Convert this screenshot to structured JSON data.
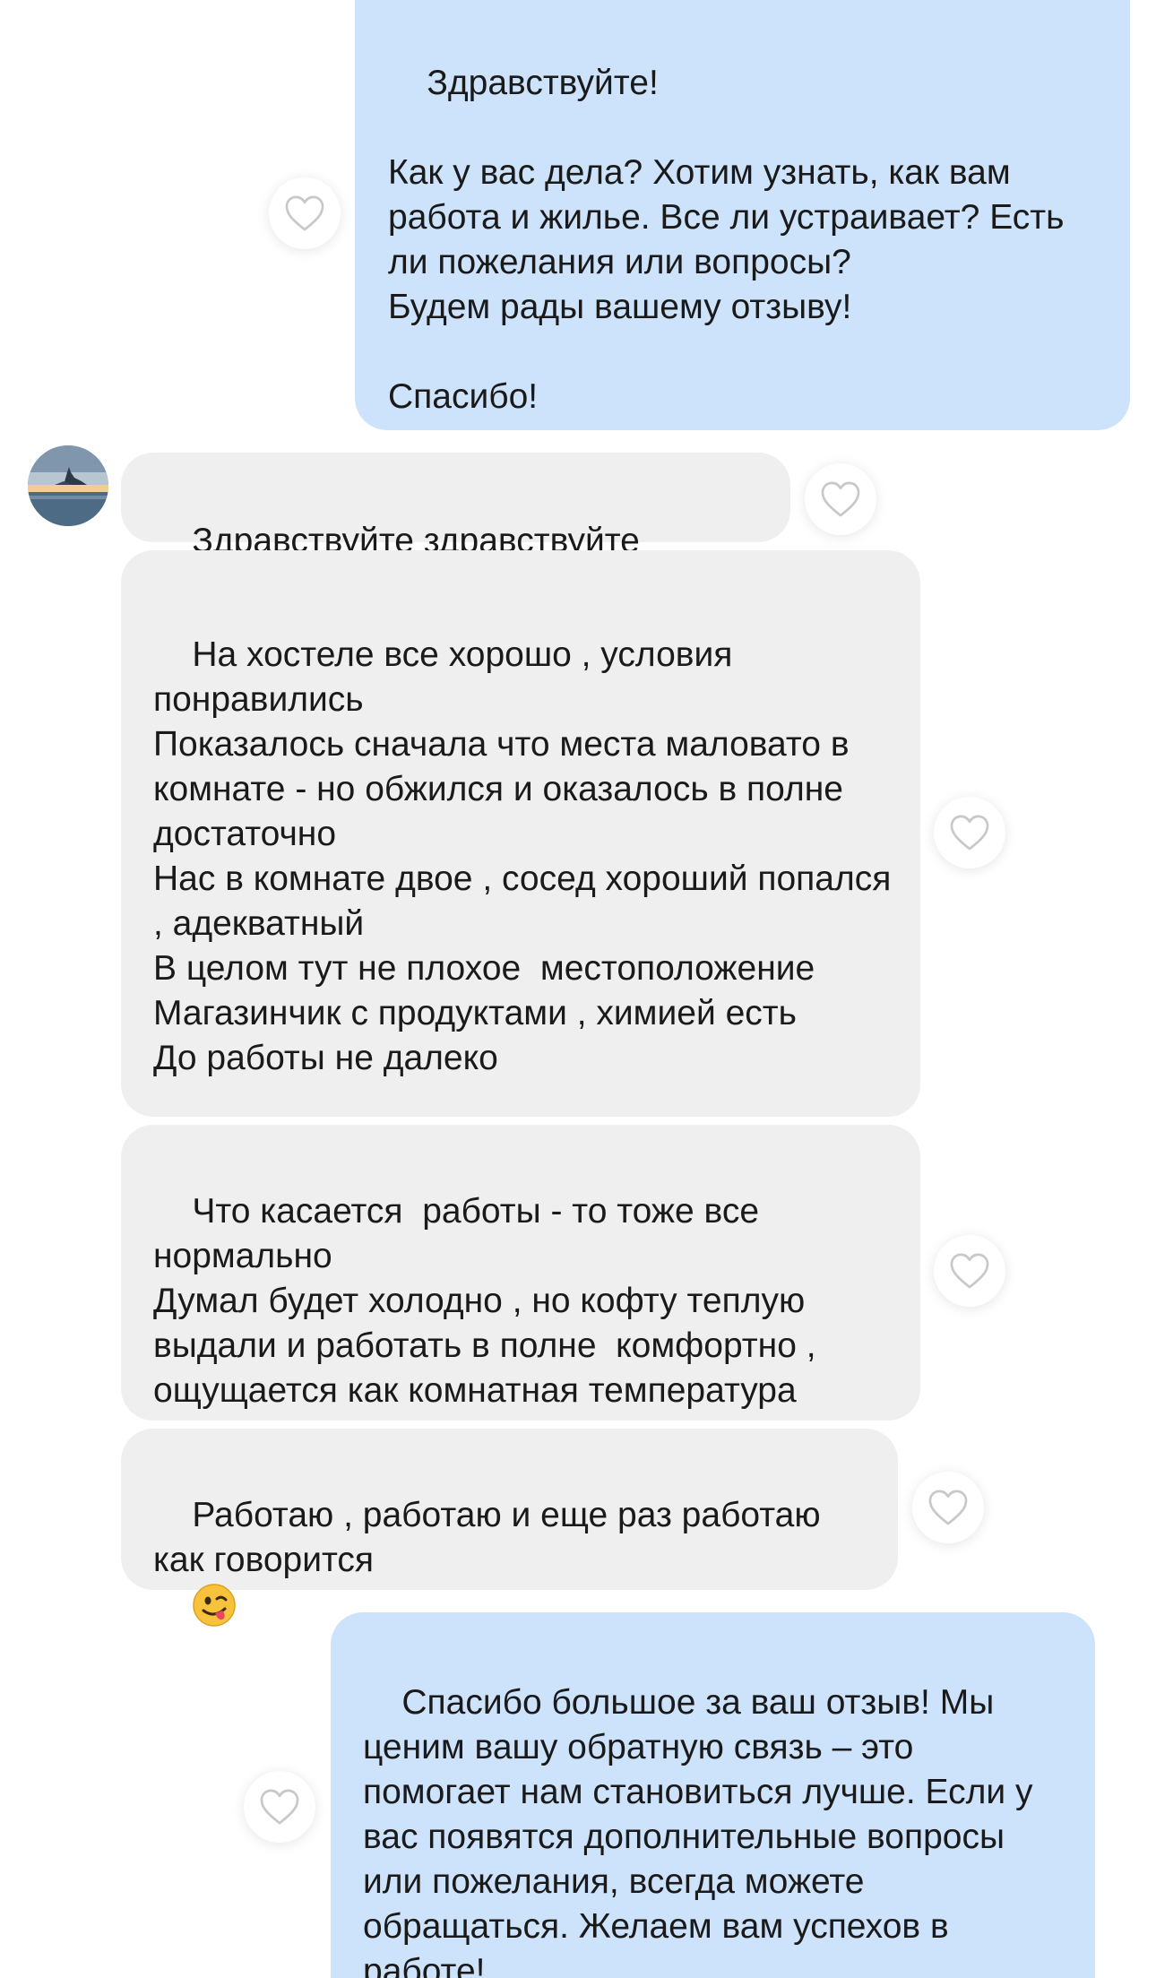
{
  "messages": [
    {
      "id": "m1",
      "direction": "outgoing",
      "text": "Здравствуйте!\n\nКак у вас дела? Хотим узнать, как вам работа и жилье. Все ли устраивает? Есть ли пожелания или вопросы?\nБудем рады вашему отзыву!\n\nСпасибо!"
    },
    {
      "id": "m2",
      "direction": "incoming",
      "text": "Здравствуйте здравствуйте"
    },
    {
      "id": "m3",
      "direction": "incoming",
      "text": "На хостеле все хорошо , условия понравились\nПоказалось сначала что места маловато в комнате - но обжился и оказалось в полне  достаточно\nНас в комнате двое , сосед хороший попался , адекватный\nВ целом тут не плохое  местоположение\nМагазинчик с продуктами , химией есть\nДо работы не далеко"
    },
    {
      "id": "m4",
      "direction": "incoming",
      "text": "Что касается  работы - то тоже все нормально\nДумал будет холодно , но кофту теплую выдали и работать в полне  комфортно , ощущается как комнатная температура"
    },
    {
      "id": "m5",
      "direction": "incoming",
      "text": "Работаю , работаю и еще раз работаю как говорится",
      "emoji": "winking-face-with-tongue"
    },
    {
      "id": "m6",
      "direction": "outgoing",
      "text": "Спасибо большое за ваш отзыв! Мы ценим вашу обратную связь – это помогает нам становиться лучше. Если у вас появятся дополнительные вопросы или пожелания, всегда можете обращаться. Желаем вам успехов в работе!"
    }
  ],
  "icons": {
    "like": "heart-outline-icon",
    "avatar": "contact-avatar"
  },
  "colors": {
    "outgoing_bubble": "#cde2fb",
    "incoming_bubble": "#efefef",
    "heart_stroke": "#c8c8c8"
  }
}
